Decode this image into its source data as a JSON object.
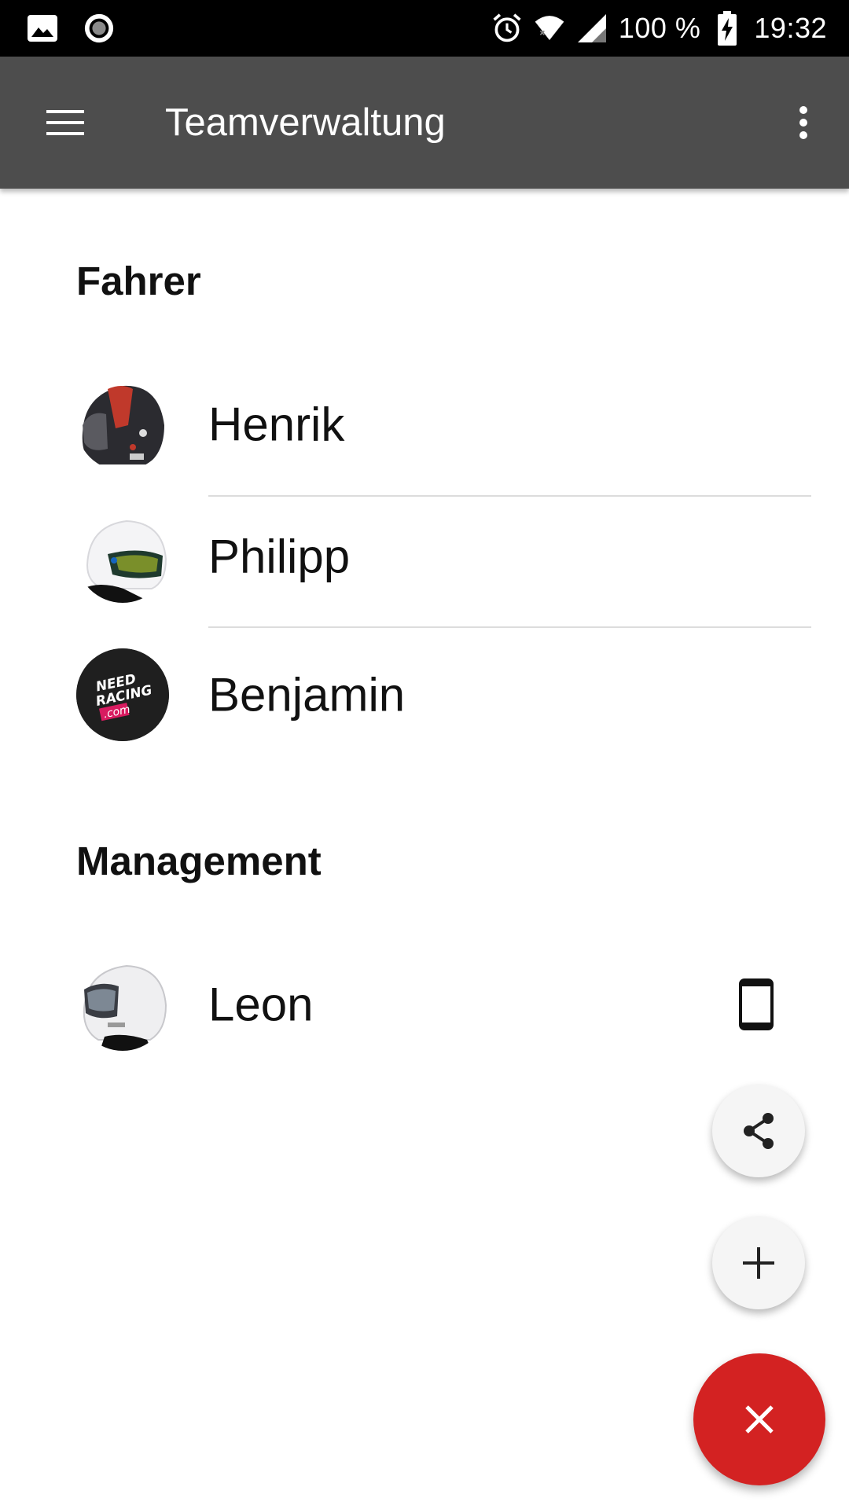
{
  "status_bar": {
    "battery": "100 %",
    "time": "19:32",
    "icons": [
      "image-icon",
      "record-icon",
      "alarm-icon",
      "wifi-icon",
      "signal-icon",
      "battery-charging-icon"
    ]
  },
  "app_bar": {
    "title": "Teamverwaltung",
    "menu_icon": "menu-icon",
    "more_icon": "more-vert-icon"
  },
  "sections": [
    {
      "title": "Fahrer",
      "members": [
        {
          "name": "Henrik",
          "avatar": "helmet-dark-red"
        },
        {
          "name": "Philipp",
          "avatar": "helmet-white-visor"
        },
        {
          "name": "Benjamin",
          "avatar": "needracing-logo"
        }
      ]
    },
    {
      "title": "Management",
      "members": [
        {
          "name": "Leon",
          "avatar": "helmet-white",
          "device_icon": "smartphone-icon"
        }
      ]
    }
  ],
  "logo": {
    "line1": "NEED",
    "line2": "RACING",
    "line3": ".com"
  },
  "colors": {
    "app_bar": "#4d4d4d",
    "status_bar": "#000000",
    "fab_main": "#d32222",
    "fab_mini": "#f5f5f5",
    "logo_pink": "#d81b60"
  },
  "fabs": [
    {
      "name": "share",
      "icon": "share-icon"
    },
    {
      "name": "add",
      "icon": "plus-icon"
    },
    {
      "name": "close",
      "icon": "close-icon"
    }
  ]
}
